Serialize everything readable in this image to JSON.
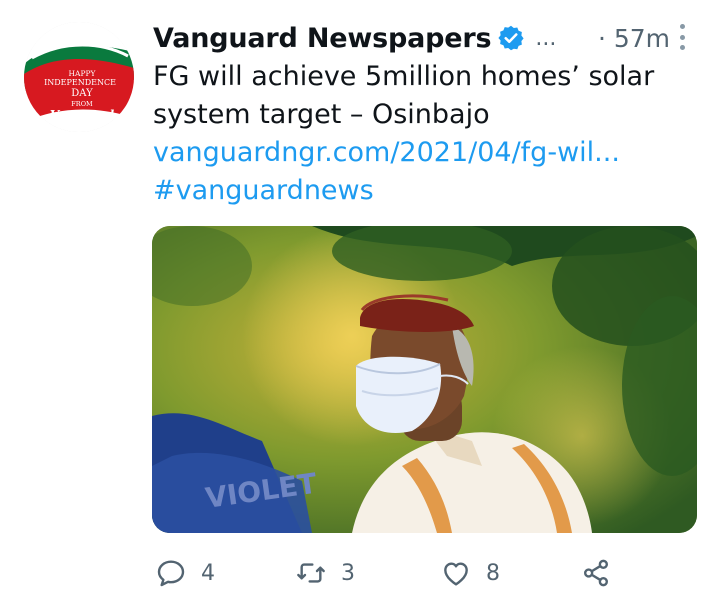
{
  "author": {
    "name": "Vanguard Newspapers",
    "handle": "...",
    "verified": true,
    "avatar_caption": [
      "HAPPY",
      "INDEPENDENCE",
      "DAY",
      "FROM",
      "Vanguard"
    ]
  },
  "timestamp": "· 57m",
  "tweet": {
    "text": "FG will achieve 5million homes’ solar system target – Osinbajo",
    "link": "vanguardngr.com/2021/04/fg-wil...",
    "hashtag": "#vanguardnews"
  },
  "media": {
    "watermark_text": "VIOLET"
  },
  "actions": {
    "reply_count": "4",
    "retweet_count": "3",
    "like_count": "8"
  },
  "icons": {
    "verified": "verified-badge-icon",
    "more": "more-vertical-icon",
    "reply": "reply-icon",
    "retweet": "retweet-icon",
    "like": "heart-icon",
    "share": "share-icon"
  },
  "colors": {
    "accent": "#1d9bf0",
    "secondary_text": "#536471",
    "primary_text": "#0f1419",
    "avatar_red": "#d71920",
    "avatar_green": "#0a7a3e"
  }
}
